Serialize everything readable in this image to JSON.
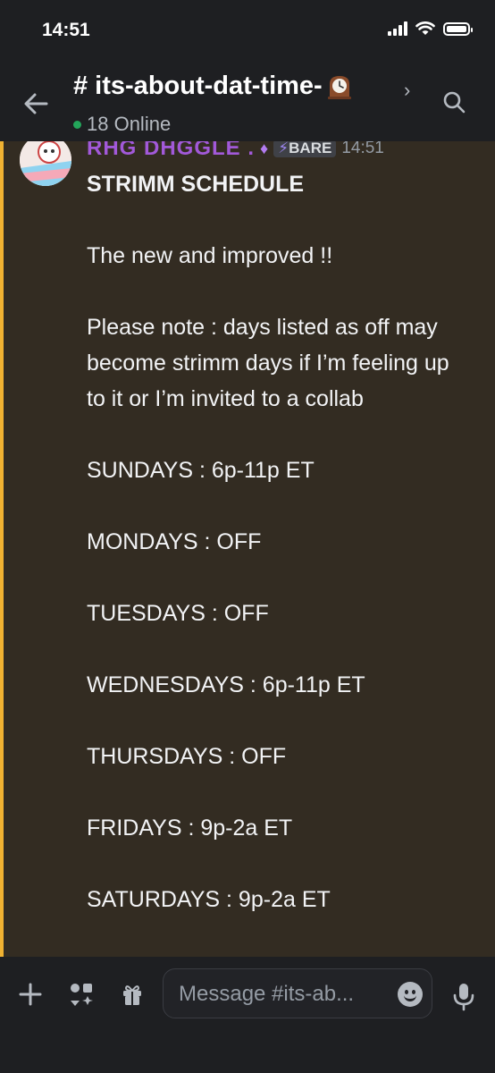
{
  "status_bar": {
    "time": "14:51"
  },
  "header": {
    "channel_name": "# its-about-dat-time-",
    "channel_emoji": "mantelpiece-clock",
    "online_count": "18 Online"
  },
  "message": {
    "username": "RHG DHGGLE .",
    "tag": "BARE",
    "timestamp": "14:51",
    "lines": [
      "STRIMM SCHEDULE",
      "The new and improved !!",
      "Please note : days listed as off may become strimm days if I’m feeling up to it or I’m invited to a collab",
      "SUNDAYS : 6p-11p ET",
      "MONDAYS : OFF",
      "TUESDAYS : OFF",
      "WEDNESDAYS : 6p-11p ET",
      "THURSDAYS : OFF",
      "FRIDAYS : 9p-2a ET",
      "SATURDAYS : 9p-2a ET"
    ]
  },
  "composer": {
    "placeholder": "Message #its-ab..."
  },
  "colors": {
    "highlight_bar": "#f0b232",
    "message_bg": "#332c22",
    "online_dot": "#23a55a",
    "username": "#a259d9"
  },
  "icons": [
    "back-arrow-icon",
    "chevron-right-icon",
    "search-icon",
    "plus-icon",
    "apps-icon",
    "gift-icon",
    "emoji-icon",
    "mic-icon",
    "signal-icon",
    "wifi-icon",
    "battery-icon"
  ]
}
